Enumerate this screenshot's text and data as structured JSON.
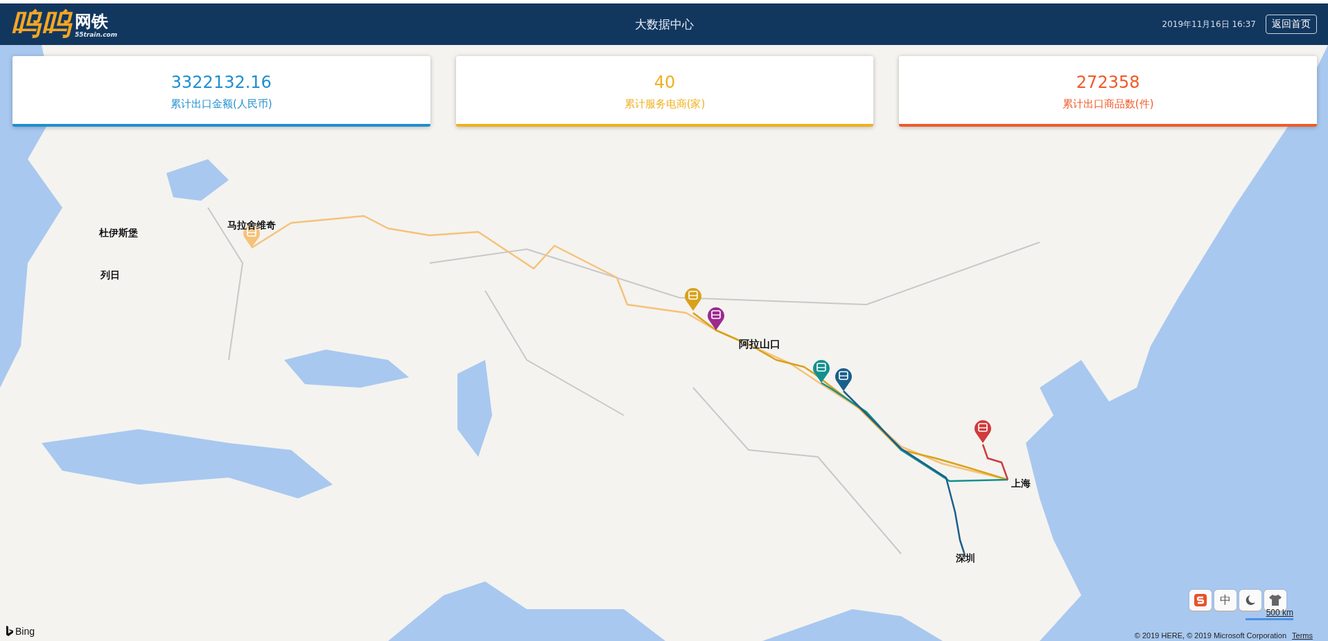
{
  "header": {
    "logo_main": "呜呜",
    "logo_sub": "网铁",
    "logo_domain": "55train.com",
    "title": "大数据中心",
    "datetime": "2019年11月16日 16:37",
    "home_button": "返回首页"
  },
  "stats": [
    {
      "value": "3322132.16",
      "label": "累计出口金额(人民币)",
      "color": "#1e8fd0"
    },
    {
      "value": "40",
      "label": "累计服务电商(家)",
      "color": "#f0b020"
    },
    {
      "value": "272358",
      "label": "累计出口商品数(件)",
      "color": "#f05a28"
    }
  ],
  "map": {
    "cities": [
      {
        "kind": "city",
        "name": "杜伊斯堡"
      },
      {
        "kind": "city",
        "name": "列日"
      },
      {
        "kind": "city",
        "name": "马拉舍维奇"
      },
      {
        "kind": "port",
        "name": "阿拉山口"
      },
      {
        "kind": "city",
        "name": "上海"
      },
      {
        "kind": "city",
        "name": "深圳"
      }
    ],
    "markers": [
      {
        "color": "#f5c27a"
      },
      {
        "color": "#d9a21b"
      },
      {
        "color": "#9c2a8f"
      },
      {
        "color": "#14908f"
      },
      {
        "color": "#1a5f8c"
      },
      {
        "color": "#d03b3b"
      }
    ],
    "provider": "Bing",
    "scale": "500 km",
    "attribution": "© 2019 HERE, © 2019 Microsoft Corporation",
    "terms": "Terms"
  },
  "ime_toolbar": {
    "language": "中"
  }
}
